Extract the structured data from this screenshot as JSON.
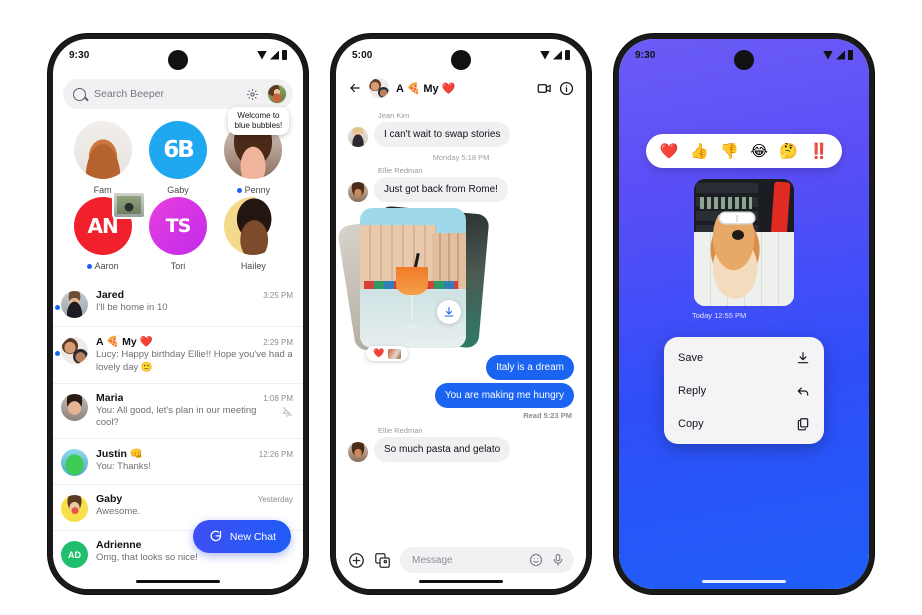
{
  "phone1": {
    "status": {
      "time": "9:30",
      "icons": [
        "wifi-icon",
        "signal-icon",
        "battery-icon"
      ]
    },
    "search": {
      "placeholder": "Search Beeper",
      "icon": "search-icon",
      "settings_icon": "gear-icon",
      "avatar": "profile-avatar"
    },
    "favorites": [
      {
        "name": "Fam",
        "monogram": "",
        "unread": false,
        "tooltip": "",
        "sticker": false
      },
      {
        "name": "Gaby",
        "monogram": "6B",
        "unread": false,
        "tooltip": "",
        "sticker": false
      },
      {
        "name": "Penny",
        "monogram": "",
        "unread": true,
        "tooltip": "Welcome to\nblue bubbles!",
        "sticker": false
      },
      {
        "name": "Aaron",
        "monogram": "AN",
        "unread": true,
        "tooltip": "",
        "sticker": true
      },
      {
        "name": "Tori",
        "monogram": "TS",
        "unread": false,
        "tooltip": "",
        "sticker": false
      },
      {
        "name": "Hailey",
        "monogram": "",
        "unread": false,
        "tooltip": "",
        "sticker": false
      }
    ],
    "chats": [
      {
        "name": "Jared",
        "time": "3:25 PM",
        "preview": "I'll be home in 10",
        "unread": true,
        "muted": false
      },
      {
        "name": "A 🍕 My ❤️",
        "time": "2:29 PM",
        "preview": "Lucy: Happy birthday Ellie!! Hope you've had a lovely day  🙂",
        "unread": true,
        "muted": false
      },
      {
        "name": "Maria",
        "time": "1:08 PM",
        "preview": "You: All good, let's plan in our meeting cool?",
        "unread": false,
        "muted": true
      },
      {
        "name": "Justin 👊",
        "time": "12:26 PM",
        "preview": "You: Thanks!",
        "unread": false,
        "muted": false
      },
      {
        "name": "Gaby",
        "time": "Yesterday",
        "preview": "Awesome.",
        "unread": false,
        "muted": false
      },
      {
        "name": "Adrienne",
        "time": "",
        "preview": "Omg, that looks so nice!",
        "unread": false,
        "muted": false,
        "initials": "AD"
      }
    ],
    "fab": {
      "label": "New Chat",
      "icon": "chat-bubble-icon"
    }
  },
  "phone2": {
    "status": {
      "time": "5:00"
    },
    "header": {
      "title": "A 🍕 My ❤️",
      "back_icon": "back-arrow-icon",
      "video_icon": "video-call-icon",
      "info_icon": "info-icon",
      "avatar": "group-avatar"
    },
    "messages": [
      {
        "type": "incoming",
        "sender": "Jean Kim",
        "text": "I can't wait to swap stories"
      },
      {
        "type": "daystamp",
        "text": "Monday 5:18 PM"
      },
      {
        "type": "incoming",
        "sender": "Ellie Redman",
        "text": "Just got back from Rome!"
      },
      {
        "type": "photo",
        "reaction": "❤️",
        "download_icon": "download-icon"
      },
      {
        "type": "outgoing",
        "text": "Italy is a dream"
      },
      {
        "type": "outgoing",
        "text": "You are making me hungry"
      },
      {
        "type": "readstamp",
        "text": "Read  5:23 PM"
      },
      {
        "type": "incoming",
        "sender": "Ellie Redman",
        "text": "So much pasta and gelato"
      }
    ],
    "composer": {
      "placeholder": "Message",
      "plus_icon": "plus-icon",
      "gallery_icon": "gallery-icon",
      "emoji_icon": "emoji-icon",
      "mic_icon": "microphone-icon"
    }
  },
  "phone3": {
    "status": {
      "time": "9:30"
    },
    "reactions": [
      "❤️",
      "👍",
      "👎",
      "😂",
      "🤔",
      "‼️"
    ],
    "photo_timestamp": "Today  12:55 PM",
    "menu": [
      {
        "label": "Save",
        "icon": "download-icon"
      },
      {
        "label": "Reply",
        "icon": "reply-arrow-icon"
      },
      {
        "label": "Copy",
        "icon": "copy-icon"
      }
    ]
  },
  "colors": {
    "accent_blue": "#1b64f2",
    "brand_purple": "#5b4ef7",
    "bubble_grey": "#f0f0f2",
    "green": "#1fbf6e"
  }
}
